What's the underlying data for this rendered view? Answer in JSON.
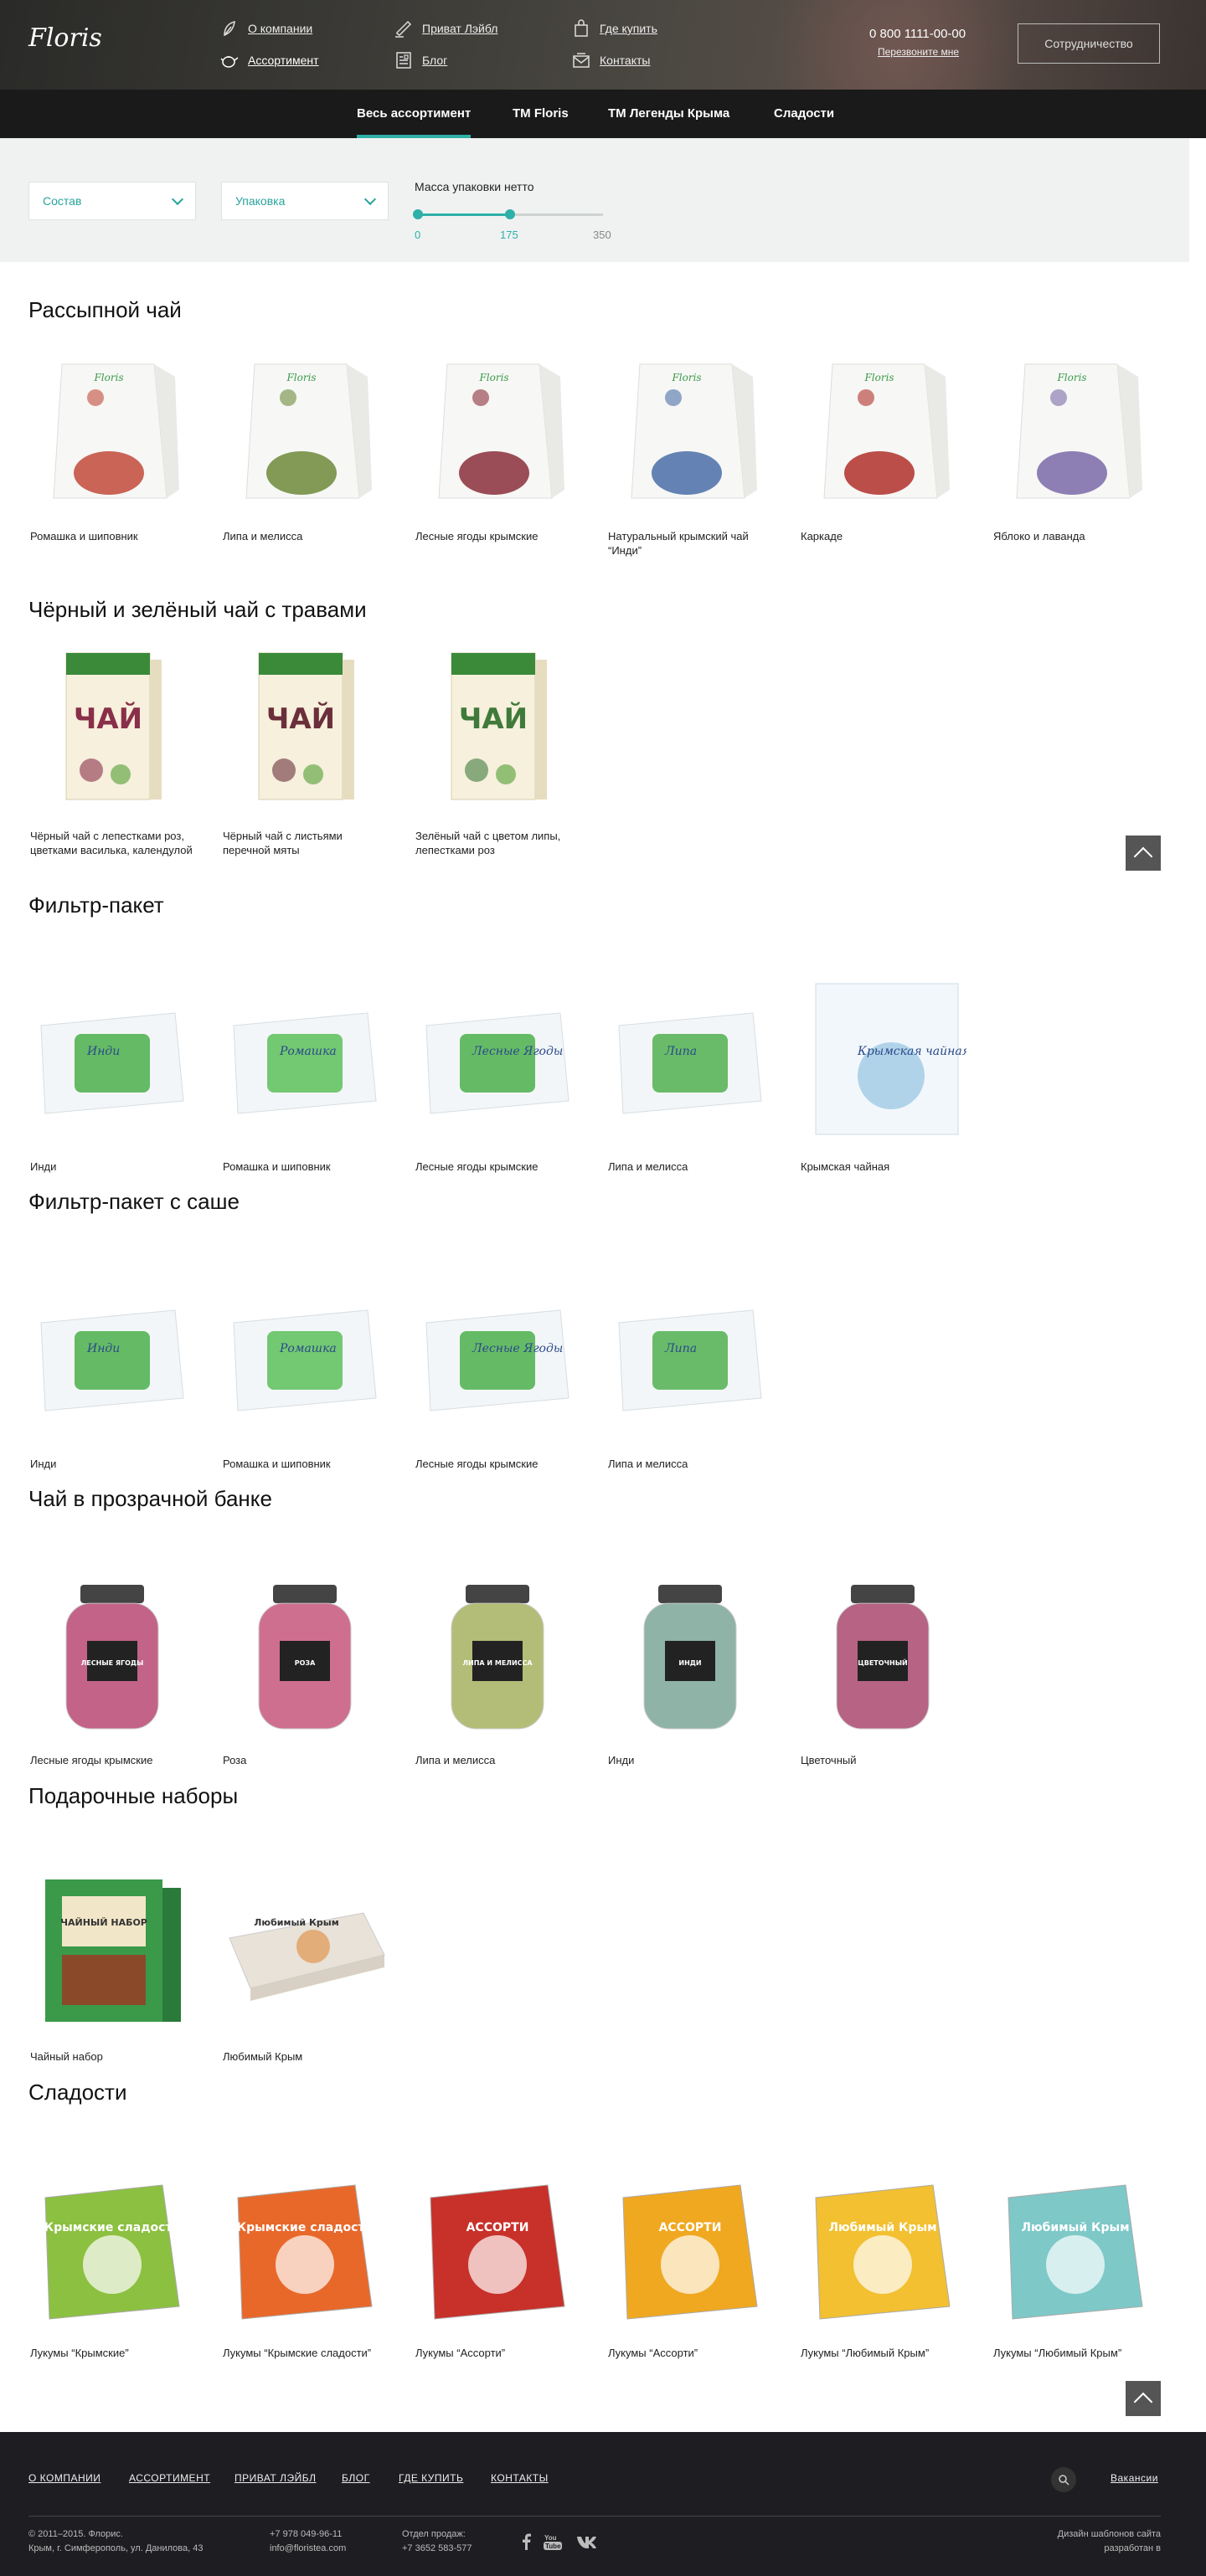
{
  "header": {
    "logo": "Floris",
    "nav": [
      {
        "label": "О компании",
        "icon": "tea-leaf-icon"
      },
      {
        "label": "Приват Лэйбл",
        "icon": "pen-label-icon"
      },
      {
        "label": "Где купить",
        "icon": "shopping-bag-icon"
      },
      {
        "label": "Ассортимент",
        "icon": "teapot-icon"
      },
      {
        "label": "Блог",
        "icon": "blog-icon"
      },
      {
        "label": "Контакты",
        "icon": "mail-icon"
      }
    ],
    "phone": "0 800 1111-00-00",
    "callback": "Перезвоните мне",
    "coop_button": "Сотрудничество"
  },
  "category_nav": {
    "items": [
      "Весь ассортимент",
      "ТМ Floris",
      "ТМ Легенды Крыма",
      "Сладости"
    ],
    "active": "Весь ассортимент"
  },
  "filters": {
    "composition": "Состав",
    "packaging": "Упаковка",
    "mass_title": "Массa упаковки нетто",
    "slider": {
      "min": "0",
      "value": "175",
      "max": "350",
      "fraction": 0.5
    }
  },
  "sections": [
    {
      "title": "Рассыпной чай",
      "kind": "pouch",
      "items": [
        {
          "name": "Ромашка и шиповник",
          "label": "Ромашка и Шиповник",
          "color": "#c24a3a"
        },
        {
          "name": "Липа и мелисса",
          "label": "Липа и Мелисса",
          "color": "#6d8a3a"
        },
        {
          "name": "Лесные ягоды крымские",
          "label": "Лесные Ягоды",
          "color": "#8a2f3a"
        },
        {
          "name": "Натуральный крымский чай “Инди”",
          "label": "Инди",
          "color": "#4a6fa8"
        },
        {
          "name": "Каркаде",
          "label": "Каркаде",
          "color": "#b0302a"
        },
        {
          "name": "Яблоко и лаванда",
          "label": "Яблоко и Лаванда",
          "color": "#7a6aa8"
        }
      ]
    },
    {
      "title": "Чёрный и зелёный чай с травами",
      "kind": "box",
      "items": [
        {
          "name": "Чёрный чай с лепестками роз, цветками василька, календулой",
          "label": "ЧАЙ",
          "color": "#8a2f4a"
        },
        {
          "name": "Чёрный чай с листьями перечной мяты",
          "label": "ЧАЙ",
          "color": "#6a2f3a"
        },
        {
          "name": "Зелёный чай с цветом липы, лепестками роз",
          "label": "ЧАЙ",
          "color": "#3f7a3a"
        }
      ]
    },
    {
      "title": "Фильтр-пакет",
      "kind": "filterbox",
      "items": [
        {
          "name": "Инди",
          "label": "Инди",
          "color": "#4bb04b"
        },
        {
          "name": "Ромашка и шиповник",
          "label": "Ромашка",
          "color": "#5cc05a"
        },
        {
          "name": "Лесные ягоды крымские",
          "label": "Лесные Ягоды",
          "color": "#4bb04b"
        },
        {
          "name": "Липа и мелисса",
          "label": "Липа",
          "color": "#50b050"
        },
        {
          "name": "Крымская чайная",
          "label": "Крымская чайная",
          "color": "#6fb0d8"
        }
      ]
    },
    {
      "title": "Фильтр-пакет с саше",
      "kind": "filterbox",
      "items": [
        {
          "name": "Инди",
          "label": "Инди",
          "color": "#4bb04b"
        },
        {
          "name": "Ромашка и шиповник",
          "label": "Ромашка",
          "color": "#5cc05a"
        },
        {
          "name": "Лесные ягоды крымские",
          "label": "Лесные Ягоды",
          "color": "#4bb04b"
        },
        {
          "name": "Липа и мелисса",
          "label": "Липа",
          "color": "#50b050"
        }
      ]
    },
    {
      "title": "Чай в прозрачной банке",
      "kind": "jar",
      "items": [
        {
          "name": "Лесные ягоды крымские",
          "label": "ЛЕСНЫЕ ЯГОДЫ",
          "color": "#b03060"
        },
        {
          "name": "Роза",
          "label": "РОЗА",
          "color": "#c0406a"
        },
        {
          "name": "Липа и мелисса",
          "label": "ЛИПА И МЕЛИССА",
          "color": "#9aa84a"
        },
        {
          "name": "Инди",
          "label": "ИНДИ",
          "color": "#6a9a8a"
        },
        {
          "name": "Цветочный",
          "label": "ЦВЕТОЧНЫЙ",
          "color": "#a0305a"
        }
      ]
    },
    {
      "title": "Подарочные наборы",
      "kind": "gift",
      "items": [
        {
          "name": "Чайный набор",
          "label": "ЧАЙНЫЙ НАБОР",
          "color": "#3a9a4a"
        },
        {
          "name": "Любимый Крым",
          "label": "Любимый Крым",
          "color": "#e8e2d8"
        }
      ]
    },
    {
      "title": "Сладости",
      "kind": "sweet",
      "items": [
        {
          "name": "Лукумы “Крымские”",
          "label": "Крымские сладости",
          "color": "#8cc040"
        },
        {
          "name": "Лукумы “Крымские сладости”",
          "label": "Крымские сладости",
          "color": "#e8682a"
        },
        {
          "name": "Лукумы “Ассорти”",
          "label": "АССОРТИ",
          "color": "#c8302a"
        },
        {
          "name": "Лукумы “Ассорти”",
          "label": "АССОРТИ",
          "color": "#f0a820"
        },
        {
          "name": "Лукумы “Любимый Крым”",
          "label": "Любимый Крым",
          "color": "#f2c030"
        },
        {
          "name": "Лукумы “Любимый Крым”",
          "label": "Любимый Крым",
          "color": "#7ec8c8"
        }
      ]
    }
  ],
  "footer": {
    "nav": [
      "О КОМПАНИИ",
      "АССОРТИМЕНТ",
      "ПРИВАТ ЛЭЙБЛ",
      "БЛОГ",
      "ГДЕ КУПИТЬ",
      "КОНТАКТЫ"
    ],
    "vacancies": "Вакансии",
    "copyright": "© 2011–2015. Флорис.",
    "address": "Крым, г. Симферополь, ул. Данилова, 43",
    "phone": "+7 978 049-96-11",
    "email": "info@floristea.com",
    "sales_label": "Отдел продаж:",
    "sales_phone": "+7 3652 583-577",
    "design_line1": "Дизайн шаблонов сайта",
    "design_line2": "разработан в"
  },
  "colors": {
    "accent": "#2eb0a8",
    "dark": "#1a1a1a",
    "footer": "#1e1e22"
  }
}
